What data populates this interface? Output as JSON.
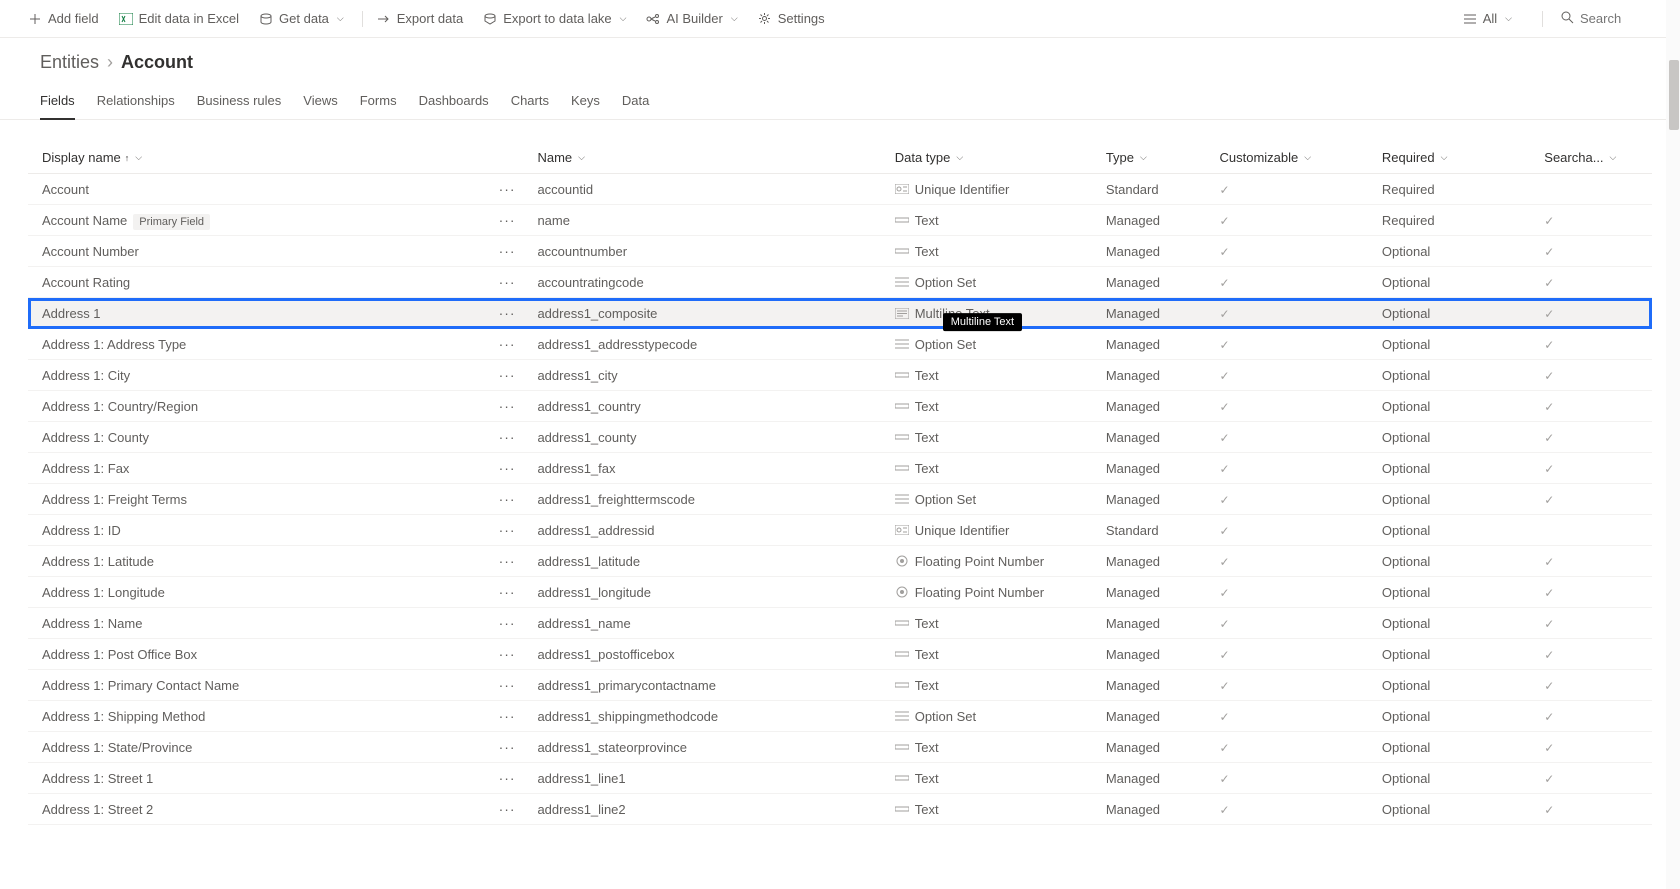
{
  "toolbar": {
    "add_field": "Add field",
    "edit_excel": "Edit data in Excel",
    "get_data": "Get data",
    "export_data": "Export data",
    "export_datalake": "Export to data lake",
    "ai_builder": "AI Builder",
    "settings": "Settings",
    "all": "All",
    "search_placeholder": "Search"
  },
  "breadcrumb": {
    "root": "Entities",
    "current": "Account"
  },
  "tabs": [
    "Fields",
    "Relationships",
    "Business rules",
    "Views",
    "Forms",
    "Dashboards",
    "Charts",
    "Keys",
    "Data"
  ],
  "active_tab": 0,
  "columns": {
    "display_name": "Display name",
    "name": "Name",
    "data_type": "Data type",
    "type": "Type",
    "customizable": "Customizable",
    "required": "Required",
    "searchable": "Searcha..."
  },
  "primary_field_badge": "Primary Field",
  "tooltip": "Multiline Text",
  "selected_row_index": 4,
  "rows": [
    {
      "display": "Account",
      "name": "accountid",
      "dtype": "Unique Identifier",
      "dicon": "id",
      "type": "Standard",
      "cust": true,
      "req": "Required",
      "search": false
    },
    {
      "display": "Account Name",
      "badge": true,
      "name": "name",
      "dtype": "Text",
      "dicon": "text",
      "type": "Managed",
      "cust": true,
      "req": "Required",
      "search": true
    },
    {
      "display": "Account Number",
      "name": "accountnumber",
      "dtype": "Text",
      "dicon": "text",
      "type": "Managed",
      "cust": true,
      "req": "Optional",
      "search": true
    },
    {
      "display": "Account Rating",
      "name": "accountratingcode",
      "dtype": "Option Set",
      "dicon": "option",
      "type": "Managed",
      "cust": true,
      "req": "Optional",
      "search": true
    },
    {
      "display": "Address 1",
      "name": "address1_composite",
      "dtype": "Multiline Text",
      "dicon": "mtext",
      "type": "Managed",
      "cust": true,
      "req": "Optional",
      "search": true
    },
    {
      "display": "Address 1: Address Type",
      "name": "address1_addresstypecode",
      "dtype": "Option Set",
      "dicon": "option",
      "type": "Managed",
      "cust": true,
      "req": "Optional",
      "search": true
    },
    {
      "display": "Address 1: City",
      "name": "address1_city",
      "dtype": "Text",
      "dicon": "text",
      "type": "Managed",
      "cust": true,
      "req": "Optional",
      "search": true
    },
    {
      "display": "Address 1: Country/Region",
      "name": "address1_country",
      "dtype": "Text",
      "dicon": "text",
      "type": "Managed",
      "cust": true,
      "req": "Optional",
      "search": true
    },
    {
      "display": "Address 1: County",
      "name": "address1_county",
      "dtype": "Text",
      "dicon": "text",
      "type": "Managed",
      "cust": true,
      "req": "Optional",
      "search": true
    },
    {
      "display": "Address 1: Fax",
      "name": "address1_fax",
      "dtype": "Text",
      "dicon": "text",
      "type": "Managed",
      "cust": true,
      "req": "Optional",
      "search": true
    },
    {
      "display": "Address 1: Freight Terms",
      "name": "address1_freighttermscode",
      "dtype": "Option Set",
      "dicon": "option",
      "type": "Managed",
      "cust": true,
      "req": "Optional",
      "search": true
    },
    {
      "display": "Address 1: ID",
      "name": "address1_addressid",
      "dtype": "Unique Identifier",
      "dicon": "id",
      "type": "Standard",
      "cust": true,
      "req": "Optional",
      "search": false
    },
    {
      "display": "Address 1: Latitude",
      "name": "address1_latitude",
      "dtype": "Floating Point Number",
      "dicon": "float",
      "type": "Managed",
      "cust": true,
      "req": "Optional",
      "search": true
    },
    {
      "display": "Address 1: Longitude",
      "name": "address1_longitude",
      "dtype": "Floating Point Number",
      "dicon": "float",
      "type": "Managed",
      "cust": true,
      "req": "Optional",
      "search": true
    },
    {
      "display": "Address 1: Name",
      "name": "address1_name",
      "dtype": "Text",
      "dicon": "text",
      "type": "Managed",
      "cust": true,
      "req": "Optional",
      "search": true
    },
    {
      "display": "Address 1: Post Office Box",
      "name": "address1_postofficebox",
      "dtype": "Text",
      "dicon": "text",
      "type": "Managed",
      "cust": true,
      "req": "Optional",
      "search": true
    },
    {
      "display": "Address 1: Primary Contact Name",
      "name": "address1_primarycontactname",
      "dtype": "Text",
      "dicon": "text",
      "type": "Managed",
      "cust": true,
      "req": "Optional",
      "search": true
    },
    {
      "display": "Address 1: Shipping Method",
      "name": "address1_shippingmethodcode",
      "dtype": "Option Set",
      "dicon": "option",
      "type": "Managed",
      "cust": true,
      "req": "Optional",
      "search": true
    },
    {
      "display": "Address 1: State/Province",
      "name": "address1_stateorprovince",
      "dtype": "Text",
      "dicon": "text",
      "type": "Managed",
      "cust": true,
      "req": "Optional",
      "search": true
    },
    {
      "display": "Address 1: Street 1",
      "name": "address1_line1",
      "dtype": "Text",
      "dicon": "text",
      "type": "Managed",
      "cust": true,
      "req": "Optional",
      "search": true
    },
    {
      "display": "Address 1: Street 2",
      "name": "address1_line2",
      "dtype": "Text",
      "dicon": "text",
      "type": "Managed",
      "cust": true,
      "req": "Optional",
      "search": true
    }
  ]
}
